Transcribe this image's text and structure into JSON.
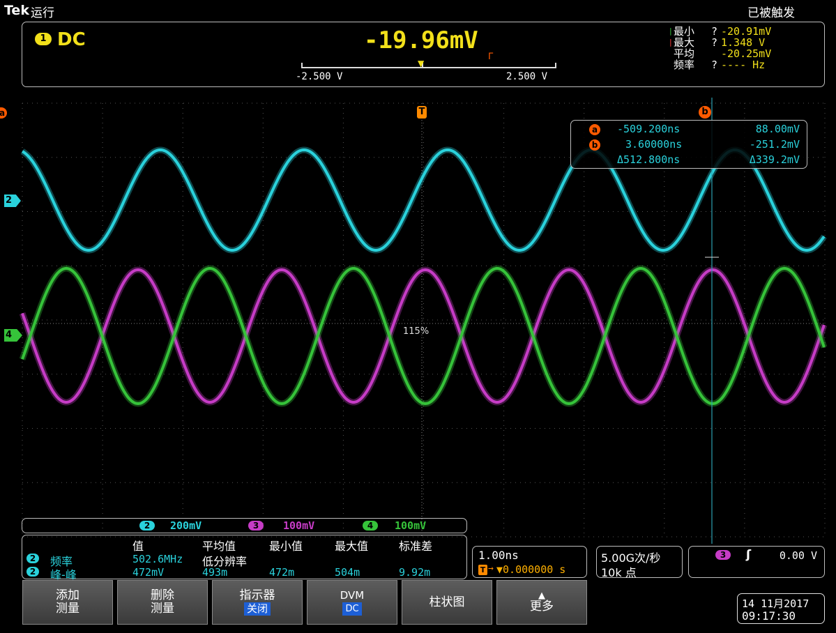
{
  "header": {
    "brand": "Tek",
    "run_state": "运行",
    "trigger_state": "已被触发"
  },
  "dvm": {
    "channel": "1",
    "mode": "DC",
    "reading": "-19.96mV",
    "scale_min": "-2.500 V",
    "scale_max": "2.500 V",
    "stats": [
      {
        "label": "最小",
        "q": "?",
        "value": "-20.91mV"
      },
      {
        "label": "最大",
        "q": "?",
        "value": "1.348 V"
      },
      {
        "label": "平均",
        "q": "",
        "value": "-20.25mV"
      },
      {
        "label": "频率",
        "q": "?",
        "value": "---- Hz"
      }
    ]
  },
  "waveform": {
    "trigger_marker": "T",
    "cursor_a_label": "a",
    "cursor_b_label": "b",
    "ch2_marker": "2",
    "ch4_marker": "4",
    "zoom_text": "115%"
  },
  "cursor_readout": {
    "a_label": "a",
    "b_label": "b",
    "a_time": "-509.200ns",
    "a_value": "88.00mV",
    "b_time": "3.60000ns",
    "b_value": "-251.2mV",
    "delta_time": "Δ512.800ns",
    "delta_value": "Δ339.2mV"
  },
  "channel_scales": [
    {
      "ch": "2",
      "scale": "200mV",
      "color": "#2ad2dc"
    },
    {
      "ch": "3",
      "scale": "100mV",
      "color": "#c63cc6"
    },
    {
      "ch": "4",
      "scale": "100mV",
      "color": "#36c33a"
    }
  ],
  "measurements": {
    "headers": [
      "值",
      "平均值",
      "最小值",
      "最大值",
      "标准差"
    ],
    "rows": [
      {
        "ch": "2",
        "name": "频率",
        "value": "502.6MHz",
        "mean": "低分辨率",
        "min": "",
        "max": "",
        "std": ""
      },
      {
        "ch": "2",
        "name": "峰-峰",
        "value": "472mV",
        "mean": "493m",
        "min": "472m",
        "max": "504m",
        "std": "9.92m"
      }
    ]
  },
  "timebase": {
    "scale": "1.00ns",
    "trigger_badge": "T",
    "position": "▼0.000000 s"
  },
  "acquisition": {
    "rate": "5.00G次/秒",
    "points": "10k 点"
  },
  "trigger": {
    "channel": "3",
    "slope": "ʃ",
    "level": "0.00 V"
  },
  "softkeys": [
    {
      "line1": "添加",
      "line2": "测量"
    },
    {
      "line1": "删除",
      "line2": "测量"
    },
    {
      "line1": "指示器",
      "line2": "关闭"
    },
    {
      "line1": "DVM",
      "line2": "DC"
    },
    {
      "line1": "柱状图",
      "line2": ""
    },
    {
      "line1": "更多",
      "line2": ""
    }
  ],
  "datetime": {
    "date": "14 11月2017",
    "time": "09:17:30"
  },
  "colors": {
    "ch1": "#f2e01a",
    "ch2": "#2ad2dc",
    "ch3": "#c63cc6",
    "ch4": "#36c33a",
    "cursor": "#ff5a00"
  }
}
